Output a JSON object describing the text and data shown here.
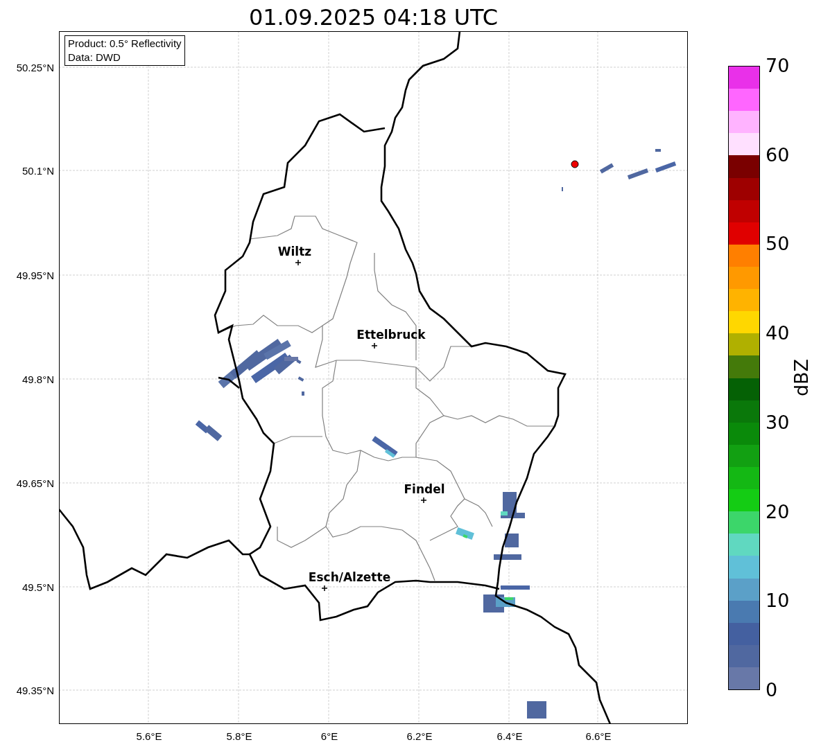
{
  "title": "01.09.2025 04:18 UTC",
  "info_box": [
    "Product: 0.5° Reflectivity",
    "Data: DWD"
  ],
  "cities": [
    {
      "name": "Wiltz"
    },
    {
      "name": "Ettelbruck"
    },
    {
      "name": "Findel"
    },
    {
      "name": "Esch/Alzette"
    }
  ],
  "y_ticks": [
    "50.25°N",
    "50.1°N",
    "49.95°N",
    "49.8°N",
    "49.65°N",
    "49.5°N",
    "49.35°N"
  ],
  "x_ticks": [
    "5.6°E",
    "5.8°E",
    "6°E",
    "6.2°E",
    "6.4°E",
    "6.6°E"
  ],
  "colorbar": {
    "label": "dBZ",
    "ticks": [
      "70",
      "60",
      "50",
      "40",
      "30",
      "20",
      "10",
      "0"
    ],
    "bins": [
      {
        "color": "#e930e9"
      },
      {
        "color": "#ff66ff"
      },
      {
        "color": "#ffb3ff"
      },
      {
        "color": "#ffe0ff"
      },
      {
        "color": "#7a0000"
      },
      {
        "color": "#9e0000"
      },
      {
        "color": "#c00000"
      },
      {
        "color": "#e00000"
      },
      {
        "color": "#ff7f00"
      },
      {
        "color": "#ff9900"
      },
      {
        "color": "#ffb300"
      },
      {
        "color": "#ffd700"
      },
      {
        "color": "#b0b000"
      },
      {
        "color": "#447a0a"
      },
      {
        "color": "#056105"
      },
      {
        "color": "#0a780a"
      },
      {
        "color": "#0a8a0a"
      },
      {
        "color": "#12a012"
      },
      {
        "color": "#14b814"
      },
      {
        "color": "#14cc14"
      },
      {
        "color": "#3cd66a"
      },
      {
        "color": "#60d8c0"
      },
      {
        "color": "#60c0d8"
      },
      {
        "color": "#5ba0c8"
      },
      {
        "color": "#4a7ab0"
      },
      {
        "color": "#4460a0"
      },
      {
        "color": "#5068a0"
      },
      {
        "color": "#6878a8"
      }
    ]
  }
}
